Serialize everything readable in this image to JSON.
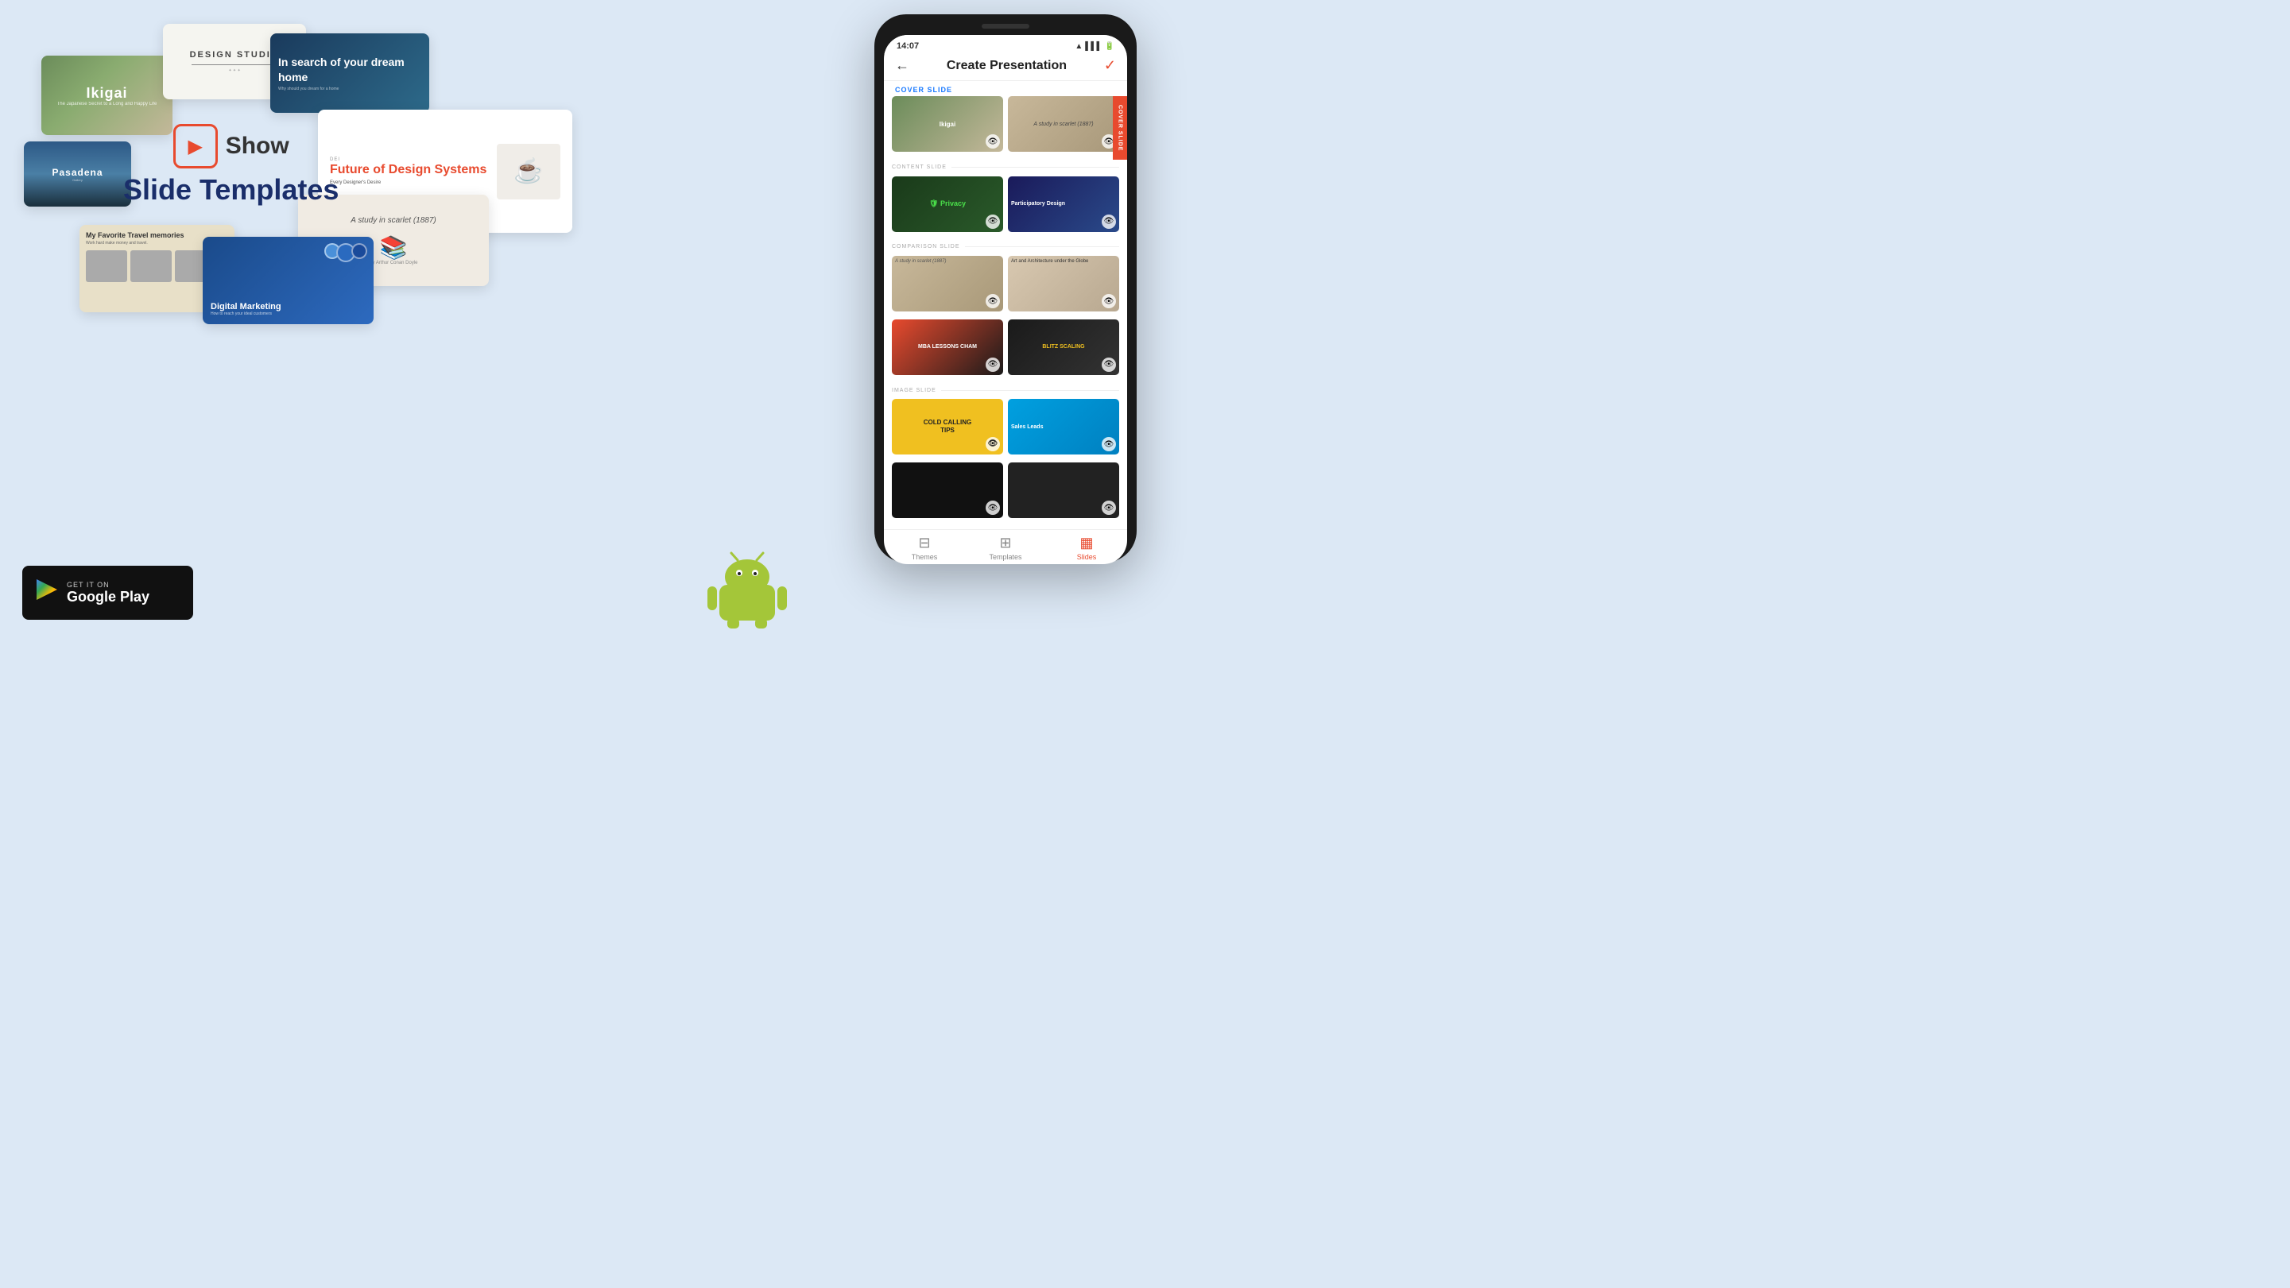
{
  "page": {
    "background": "#dce8f5"
  },
  "hero": {
    "logo_icon": "▶",
    "show_label": "Show",
    "tagline": "Slide Templates"
  },
  "cards": {
    "ikigai": {
      "title": "Ikigai",
      "subtitle": "The Japanese Secret to a Long and Happy Life"
    },
    "design_studio": {
      "title": "DESIGN STUDIO"
    },
    "dream_home": {
      "title": "In search of your dream home",
      "subtitle": "Why should you dream for a home"
    },
    "pasadena": {
      "title": "Pasadena",
      "subtitle": "Gallery"
    },
    "future": {
      "label": "DEI",
      "title": "Future of Design Systems",
      "subtitle": "Every Designer's Desire"
    },
    "travel": {
      "title": "My Favorite Travel memories",
      "subtitle": "Work hard make money and travel."
    },
    "scarlet": {
      "title": "A study in scarlet (1887)",
      "subtitle": "By Arthur Conan Doyle"
    },
    "digital": {
      "title": "Digital Marketing",
      "subtitle": "How to reach your ideal customers"
    }
  },
  "google_play": {
    "get_it_on": "GET IT ON",
    "store_name": "Google Play"
  },
  "phone": {
    "time": "14:07",
    "header_title": "Create Presentation",
    "back_icon": "←",
    "check_icon": "✓",
    "cover_slide_label": "COVER SLIDE",
    "sections": [
      {
        "id": "cover",
        "label": "COVER SLIDE"
      },
      {
        "id": "content",
        "label": "CONTENT SLIDE"
      },
      {
        "id": "comparison",
        "label": "COMPARISON SLIDE"
      },
      {
        "id": "image",
        "label": "IMAGE SLIDE"
      }
    ],
    "slides": [
      {
        "id": "ikigai",
        "type": "cover",
        "class": "thumb-ikigai"
      },
      {
        "id": "book",
        "type": "cover",
        "class": "thumb-book"
      },
      {
        "id": "privacy",
        "type": "content",
        "label": "Privacy",
        "class": "thumb-privacy"
      },
      {
        "id": "participatory",
        "type": "content",
        "label": "Participatory Design",
        "class": "thumb-participatory"
      },
      {
        "id": "scarlet-c",
        "type": "comparison",
        "class": "thumb-scarlet"
      },
      {
        "id": "art",
        "type": "comparison",
        "label": "Art and Architecture under the Clobe",
        "class": "thumb-art"
      },
      {
        "id": "mba",
        "type": "comparison",
        "label": "MBA LESSONS CHAM",
        "class": "thumb-mba"
      },
      {
        "id": "blitz",
        "type": "comparison",
        "label": "BLITZ SCALING",
        "class": "thumb-blitz"
      },
      {
        "id": "cold",
        "type": "image",
        "label": "COLD CALLING TIPS",
        "class": "thumb-cold-tips"
      },
      {
        "id": "sales",
        "type": "image",
        "label": "Sales Leads",
        "class": "thumb-sales"
      },
      {
        "id": "dark1",
        "type": "extra",
        "class": "thumb-dark1"
      },
      {
        "id": "dark2",
        "type": "extra",
        "class": "thumb-dark2"
      }
    ],
    "nav": [
      {
        "id": "themes",
        "label": "Themes",
        "icon": "◻",
        "active": false
      },
      {
        "id": "templates",
        "label": "Templates",
        "icon": "⊞",
        "active": false
      },
      {
        "id": "slides",
        "label": "Slides",
        "icon": "▦",
        "active": true
      }
    ]
  }
}
